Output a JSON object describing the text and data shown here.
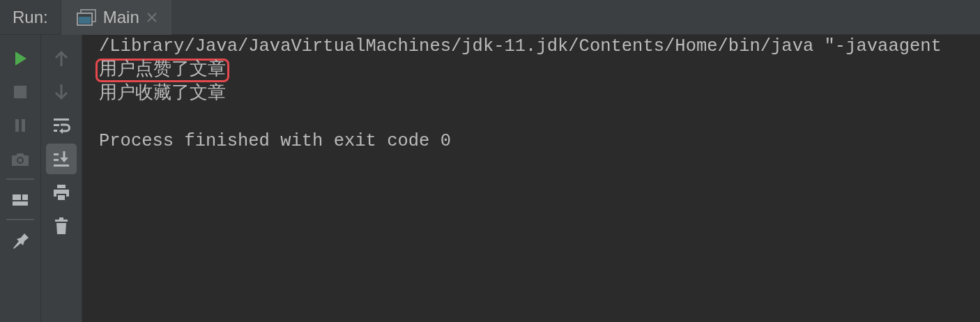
{
  "header": {
    "label": "Run:",
    "tabs": [
      {
        "label": "Main",
        "selected": true
      }
    ]
  },
  "toolbar_1": [
    {
      "kind": "run",
      "disabled": false
    },
    {
      "kind": "stop",
      "disabled": true
    },
    {
      "kind": "pause",
      "disabled": true
    },
    {
      "kind": "camera",
      "disabled": true
    },
    {
      "kind": "separator"
    },
    {
      "kind": "layout",
      "disabled": false
    },
    {
      "kind": "separator"
    },
    {
      "kind": "pin",
      "disabled": false
    }
  ],
  "toolbar_2": [
    {
      "kind": "up",
      "disabled": true,
      "selected": false
    },
    {
      "kind": "down",
      "disabled": true,
      "selected": false
    },
    {
      "kind": "wrap",
      "disabled": false,
      "selected": false
    },
    {
      "kind": "scroll-end",
      "disabled": false,
      "selected": true
    },
    {
      "kind": "print",
      "disabled": false,
      "selected": false
    },
    {
      "kind": "trash",
      "disabled": false,
      "selected": false
    }
  ],
  "console": {
    "lines": [
      {
        "text": "/Library/Java/JavaVirtualMachines/jdk-11.jdk/Contents/Home/bin/java \"-javaagent",
        "highlighted": false
      },
      {
        "text": "用户点赞了文章",
        "highlighted": true
      },
      {
        "text": "用户收藏了文章",
        "highlighted": false
      }
    ],
    "exit_message": "Process finished with exit code 0"
  }
}
